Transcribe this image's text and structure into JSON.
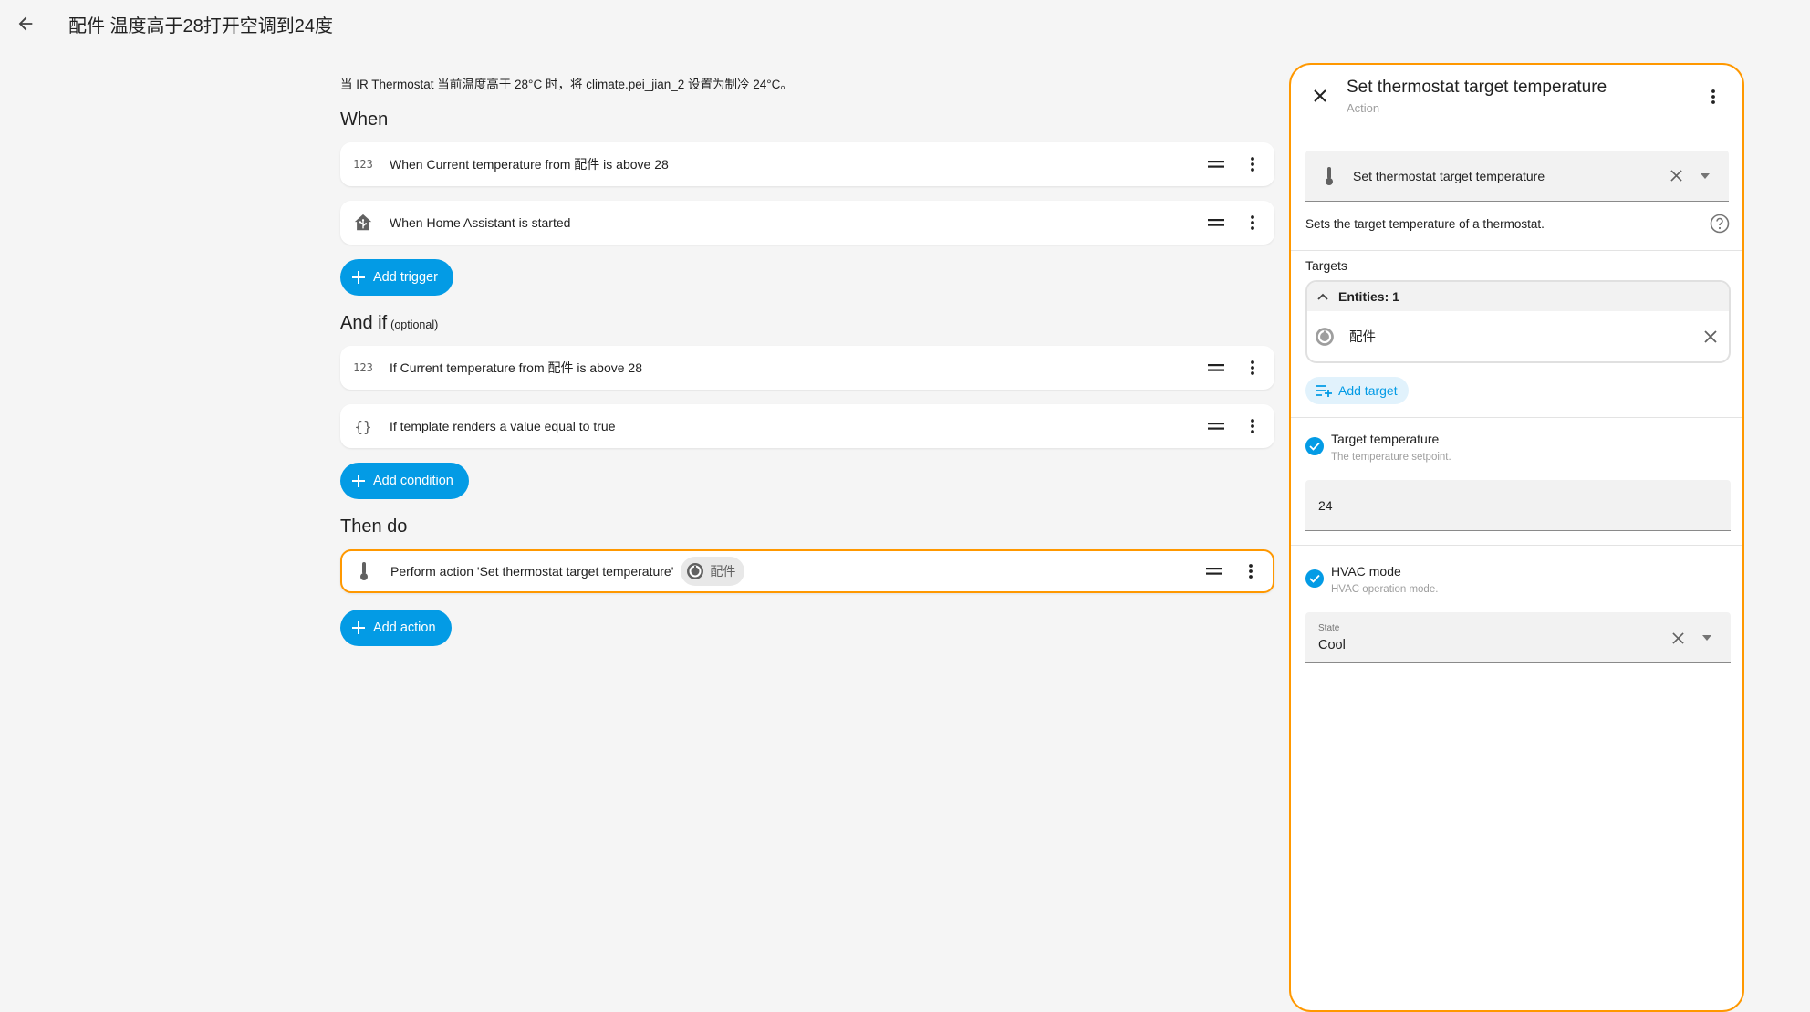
{
  "header": {
    "title": "配件 温度高于28打开空调到24度"
  },
  "main": {
    "description": "当 IR Thermostat 当前温度高于 28°C 时，将 climate.pei_jian_2 设置为制冷 24°C。",
    "when": {
      "heading": "When",
      "triggers": [
        {
          "icon": "numeric-123-icon",
          "icon_text": "123",
          "text": "When Current temperature from 配件 is above 28"
        },
        {
          "icon": "home-assistant-icon",
          "text": "When Home Assistant is started"
        }
      ],
      "add_label": "Add trigger"
    },
    "and_if": {
      "heading": "And if",
      "optional": "(optional)",
      "conditions": [
        {
          "icon": "numeric-123-icon",
          "icon_text": "123",
          "text": "If Current temperature from 配件 is above 28"
        },
        {
          "icon": "code-braces-icon",
          "icon_text": "{}",
          "text": "If template renders a value equal to true"
        }
      ],
      "add_label": "Add condition"
    },
    "then_do": {
      "heading": "Then do",
      "actions": [
        {
          "icon": "thermometer-icon",
          "text": "Perform action 'Set thermostat target temperature'",
          "chip": "配件"
        }
      ],
      "add_label": "Add action"
    }
  },
  "panel": {
    "title": "Set thermostat target temperature",
    "subtitle": "Action",
    "service_field": {
      "icon": "thermometer-icon",
      "value": "Set thermostat target temperature"
    },
    "service_description": "Sets the target temperature of a thermostat.",
    "targets": {
      "label": "Targets",
      "entities_header": "Entities: 1",
      "entities": [
        {
          "icon": "thermostat-icon",
          "name": "配件"
        }
      ],
      "add_label": "Add target"
    },
    "target_temperature": {
      "checked": true,
      "label": "Target temperature",
      "help": "The temperature setpoint.",
      "value": "24"
    },
    "hvac_mode": {
      "checked": true,
      "label": "HVAC mode",
      "help": "HVAC operation mode.",
      "field_label": "State",
      "value": "Cool"
    }
  },
  "colors": {
    "accent": "#039be5",
    "selected_border": "#ff9800",
    "background": "#f5f5f5"
  }
}
